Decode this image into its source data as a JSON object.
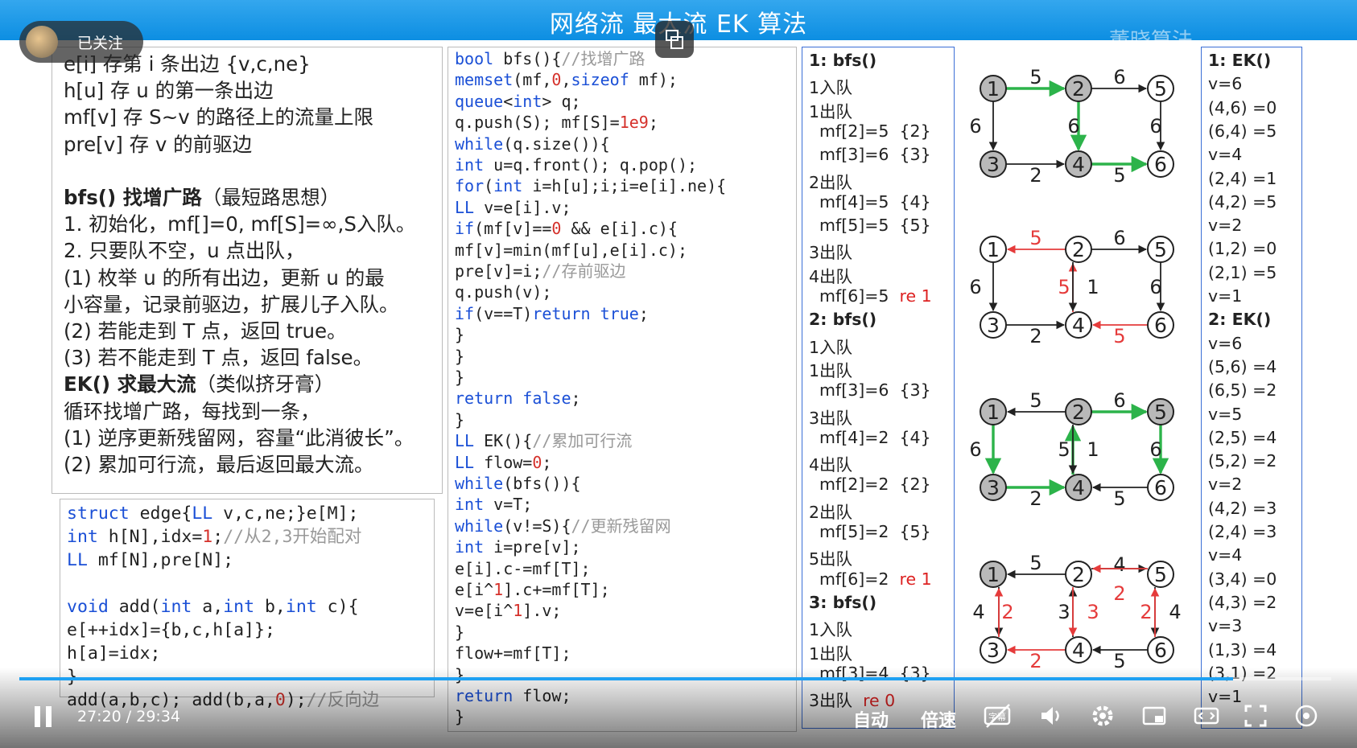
{
  "slide": {
    "title": "网络流 最大流 EK 算法",
    "watermark": "董晓算法"
  },
  "overlay": {
    "follow_label": "已关注"
  },
  "notes": {
    "lines": [
      "e[i] 存第 i 条出边 {v,c,ne}",
      "h[u] 存 u 的第一条出边",
      "mf[v] 存 S~v 的路径上的流量上限",
      "pre[v] 存 v 的前驱边",
      "",
      "bfs() 找增广路",
      "1. 初始化，mf[]=0, mf[S]=∞,S入队。",
      "2. 只要队不空，u 点出队，",
      "  (1) 枚举 u 的所有出边，更新 u 的最",
      "小容量，记录前驱边，扩展儿子入队。",
      "  (2) 若能走到 T 点，返回 true。",
      "  (3) 若不能走到 T 点，返回 false。",
      "EK() 求最大流",
      "循环找增广路，每找到一条，",
      "(1) 逆序更新残留网，容量“此消彼长”。",
      "(2) 累加可行流，最后返回最大流。"
    ],
    "bfs_note": "（最短路思想）",
    "ek_note": "（类似挤牙膏）"
  },
  "code_struct": [
    "struct edge{LL v,c,ne;}e[M];",
    "int h[N],idx=1;//从2,3开始配对",
    "LL mf[N],pre[N];",
    "",
    "void add(int a,int b,int c){",
    "  e[++idx]={b,c,h[a]};",
    "  h[a]=idx;",
    "}",
    "add(a,b,c); add(b,a,0);//反向边"
  ],
  "code_bfs": [
    "bool bfs(){//找增广路",
    "  memset(mf,0,sizeof mf);",
    "  queue<int> q;",
    "  q.push(S); mf[S]=1e9;",
    "  while(q.size()){",
    "    int u=q.front(); q.pop();",
    "    for(int i=h[u];i;i=e[i].ne){",
    "      LL v=e[i].v;",
    "      if(mf[v]==0 && e[i].c){",
    "        mf[v]=min(mf[u],e[i].c);",
    "        pre[v]=i;//存前驱边",
    "        q.push(v);",
    "        if(v==T)return true;",
    "      }",
    "    }",
    "  }",
    "  return false;",
    "}",
    "LL EK(){//累加可行流",
    "  LL flow=0;",
    "  while(bfs()){",
    "    int v=T;",
    "    while(v!=S){//更新残留网",
    "      int i=pre[v];",
    "      e[i].c-=mf[T];",
    "      e[i^1].c+=mf[T];",
    "      v=e[i^1].v;",
    "    }",
    "    flow+=mf[T];",
    "  }",
    "  return flow;",
    "}"
  ],
  "bfs_trace": [
    {
      "text": "1: bfs()",
      "kind": "head"
    },
    {
      "text": "1入队",
      "kind": "plain"
    },
    {
      "text": "1出队",
      "kind": "plain"
    },
    {
      "text": "  mf[2]=5  {2}",
      "kind": "plain"
    },
    {
      "text": "  mf[3]=6  {3}",
      "kind": "plain"
    },
    {
      "text": "2出队",
      "kind": "plain"
    },
    {
      "text": "  mf[4]=5  {4}",
      "kind": "plain"
    },
    {
      "text": "  mf[5]=5  {5}",
      "kind": "plain"
    },
    {
      "text": "3出队",
      "kind": "plain"
    },
    {
      "text": "4出队",
      "kind": "plain"
    },
    {
      "text": "  mf[6]=5",
      "kind": "ret",
      "ret": "re 1"
    },
    {
      "text": "2: bfs()",
      "kind": "head"
    },
    {
      "text": "1入队",
      "kind": "plain"
    },
    {
      "text": "1出队",
      "kind": "plain"
    },
    {
      "text": "  mf[3]=6  {3}",
      "kind": "plain"
    },
    {
      "text": "3出队",
      "kind": "plain"
    },
    {
      "text": "  mf[4]=2  {4}",
      "kind": "plain"
    },
    {
      "text": "4出队",
      "kind": "plain"
    },
    {
      "text": "  mf[2]=2  {2}",
      "kind": "plain"
    },
    {
      "text": "2出队",
      "kind": "plain"
    },
    {
      "text": "  mf[5]=2  {5}",
      "kind": "plain"
    },
    {
      "text": "5出队",
      "kind": "plain"
    },
    {
      "text": "  mf[6]=2",
      "kind": "ret",
      "ret": "re 1"
    },
    {
      "text": "3: bfs()",
      "kind": "head"
    },
    {
      "text": "1入队",
      "kind": "plain"
    },
    {
      "text": "1出队",
      "kind": "plain"
    },
    {
      "text": "  mf[3]=4  {3}",
      "kind": "plain"
    },
    {
      "text": "3出队",
      "kind": "ret",
      "ret": "re 0"
    }
  ],
  "ek_trace": [
    {
      "text": "1: EK()",
      "kind": "head"
    },
    {
      "text": "v=6",
      "kind": "plain"
    },
    {
      "text": "(4,6) =0",
      "kind": "plain"
    },
    {
      "text": "(6,4) =5",
      "kind": "plain"
    },
    {
      "text": "v=4",
      "kind": "plain"
    },
    {
      "text": "(2,4) =1",
      "kind": "plain"
    },
    {
      "text": "(4,2) =5",
      "kind": "plain"
    },
    {
      "text": "v=2",
      "kind": "plain"
    },
    {
      "text": "(1,2) =0",
      "kind": "plain"
    },
    {
      "text": "(2,1) =5",
      "kind": "plain"
    },
    {
      "text": "v=1",
      "kind": "plain"
    },
    {
      "text": "2: EK()",
      "kind": "head"
    },
    {
      "text": "v=6",
      "kind": "plain"
    },
    {
      "text": "(5,6) =4",
      "kind": "plain"
    },
    {
      "text": "(6,5) =2",
      "kind": "plain"
    },
    {
      "text": "v=5",
      "kind": "plain"
    },
    {
      "text": "(2,5) =4",
      "kind": "plain"
    },
    {
      "text": "(5,2) =2",
      "kind": "plain"
    },
    {
      "text": "v=2",
      "kind": "plain"
    },
    {
      "text": "(4,2) =3",
      "kind": "plain"
    },
    {
      "text": "(2,4) =3",
      "kind": "plain"
    },
    {
      "text": "v=4",
      "kind": "plain"
    },
    {
      "text": "(3,4) =0",
      "kind": "plain"
    },
    {
      "text": "(4,3) =2",
      "kind": "plain"
    },
    {
      "text": "v=3",
      "kind": "plain"
    },
    {
      "text": "(1,3) =4",
      "kind": "plain"
    },
    {
      "text": "(3,1) =2",
      "kind": "plain"
    },
    {
      "text": "v=1",
      "kind": "plain"
    }
  ],
  "graphs": [
    {
      "edges": [
        {
          "from": 1,
          "to": 2,
          "w": "5",
          "color": "#2cb34a"
        },
        {
          "from": 2,
          "to": 5,
          "w": "6",
          "color": "#222"
        },
        {
          "from": 1,
          "to": 3,
          "w": "6",
          "color": "#222"
        },
        {
          "from": 2,
          "to": 4,
          "w": "6",
          "color": "#2cb34a"
        },
        {
          "from": 5,
          "to": 6,
          "w": "6",
          "color": "#222"
        },
        {
          "from": 3,
          "to": 4,
          "w": "2",
          "color": "#222"
        },
        {
          "from": 4,
          "to": 6,
          "w": "5",
          "color": "#2cb34a"
        }
      ],
      "gray": [
        1,
        2,
        3,
        4
      ]
    },
    {
      "edges": [
        {
          "from": 2,
          "to": 1,
          "w": "5",
          "color": "#e53b3b",
          "wcolor": "#e53b3b"
        },
        {
          "from": 2,
          "to": 5,
          "w": "6",
          "color": "#222"
        },
        {
          "from": 1,
          "to": 3,
          "w": "6",
          "color": "#222"
        },
        {
          "from": 4,
          "to": 2,
          "w": "5",
          "color": "#e53b3b",
          "wcolor": "#e53b3b",
          "off": -7
        },
        {
          "from": 2,
          "to": 4,
          "w": "1",
          "color": "#222",
          "off": 7
        },
        {
          "from": 5,
          "to": 6,
          "w": "6",
          "color": "#222"
        },
        {
          "from": 3,
          "to": 4,
          "w": "2",
          "color": "#222"
        },
        {
          "from": 6,
          "to": 4,
          "w": "5",
          "color": "#e53b3b",
          "wcolor": "#e53b3b"
        }
      ],
      "gray": []
    },
    {
      "edges": [
        {
          "from": 2,
          "to": 1,
          "w": "5",
          "color": "#222"
        },
        {
          "from": 2,
          "to": 5,
          "w": "6",
          "color": "#2cb34a"
        },
        {
          "from": 1,
          "to": 3,
          "w": "6",
          "color": "#2cb34a"
        },
        {
          "from": 4,
          "to": 2,
          "w": "5",
          "color": "#2cb34a",
          "off": -7
        },
        {
          "from": 2,
          "to": 4,
          "w": "1",
          "color": "#222",
          "off": 7
        },
        {
          "from": 5,
          "to": 6,
          "w": "6",
          "color": "#2cb34a"
        },
        {
          "from": 3,
          "to": 4,
          "w": "2",
          "color": "#2cb34a"
        },
        {
          "from": 6,
          "to": 4,
          "w": "5",
          "color": "#222"
        }
      ],
      "gray": [
        1,
        2,
        3,
        4,
        5
      ]
    },
    {
      "edges": [
        {
          "from": 2,
          "to": 1,
          "w": "5",
          "color": "#222"
        },
        {
          "from": 2,
          "to": 5,
          "w": "4",
          "color": "#222",
          "off": -7
        },
        {
          "from": 5,
          "to": 2,
          "w": "2",
          "color": "#e53b3b",
          "wcolor": "#e53b3b",
          "off": 7
        },
        {
          "from": 1,
          "to": 3,
          "w": "4",
          "color": "#222",
          "off": -7
        },
        {
          "from": 3,
          "to": 1,
          "w": "2",
          "color": "#e53b3b",
          "wcolor": "#e53b3b",
          "off": 7
        },
        {
          "from": 4,
          "to": 2,
          "w": "3",
          "color": "#222",
          "off": -7
        },
        {
          "from": 2,
          "to": 4,
          "w": "3",
          "color": "#e53b3b",
          "wcolor": "#e53b3b",
          "off": 7
        },
        {
          "from": 5,
          "to": 6,
          "w": "4",
          "color": "#222",
          "off": 7
        },
        {
          "from": 6,
          "to": 5,
          "w": "2",
          "color": "#e53b3b",
          "wcolor": "#e53b3b",
          "off": -7
        },
        {
          "from": 4,
          "to": 3,
          "w": "2",
          "color": "#e53b3b",
          "wcolor": "#e53b3b"
        },
        {
          "from": 6,
          "to": 4,
          "w": "5",
          "color": "#222"
        }
      ],
      "gray": [
        1
      ]
    }
  ],
  "player": {
    "time": "27:20 / 29:34",
    "progress": 0.925,
    "auto_label": "自动",
    "speed_label": "倍速",
    "subtitle_label": "字幕",
    "icons": [
      "pause-icon",
      "subtitle-icon",
      "volume-icon",
      "settings-icon",
      "pip-icon",
      "widescreen-icon",
      "fullscreen-icon",
      "danmaku-icon"
    ]
  }
}
